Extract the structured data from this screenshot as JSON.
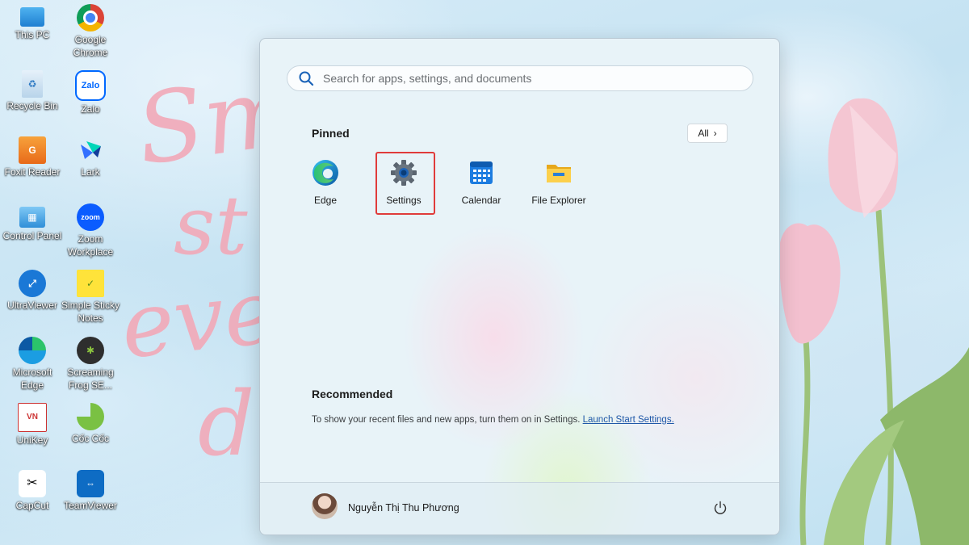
{
  "desktop": {
    "icons": [
      {
        "label": "This PC",
        "icon": "computer-icon"
      },
      {
        "label": "Google Chrome",
        "icon": "chrome-icon"
      },
      {
        "label": "Recycle Bin",
        "icon": "recycle-bin-icon"
      },
      {
        "label": "Zalo",
        "icon": "zalo-icon"
      },
      {
        "label": "Foxit Reader",
        "icon": "foxit-icon"
      },
      {
        "label": "Lark",
        "icon": "lark-icon"
      },
      {
        "label": "Control Panel",
        "icon": "control-panel-icon"
      },
      {
        "label": "Zoom Workplace",
        "icon": "zoom-icon"
      },
      {
        "label": "UltraViewer",
        "icon": "ultraviewer-icon"
      },
      {
        "label": "Simple Sticky Notes",
        "icon": "sticky-notes-icon"
      },
      {
        "label": "Microsoft Edge",
        "icon": "edge-icon"
      },
      {
        "label": "Screaming Frog SE...",
        "icon": "screaming-frog-icon"
      },
      {
        "label": "UniKey",
        "icon": "unikey-icon"
      },
      {
        "label": "Cốc Cốc",
        "icon": "coccoc-icon"
      },
      {
        "label": "CapCut",
        "icon": "capcut-icon"
      },
      {
        "label": "TeamViewer",
        "icon": "teamviewer-icon"
      }
    ]
  },
  "start_menu": {
    "search": {
      "placeholder": "Search for apps, settings, and documents"
    },
    "pinned": {
      "title": "Pinned",
      "all_label": "All",
      "apps": [
        {
          "label": "Edge",
          "icon": "edge-icon"
        },
        {
          "label": "Settings",
          "icon": "settings-gear-icon",
          "highlighted": true
        },
        {
          "label": "Calendar",
          "icon": "calendar-icon"
        },
        {
          "label": "File Explorer",
          "icon": "folder-icon"
        }
      ]
    },
    "recommended": {
      "title": "Recommended",
      "message": "To show your recent files and new apps, turn them on in Settings.",
      "link": "Launch Start Settings."
    },
    "user": {
      "name": "Nguyễn Thị Thu Phương"
    }
  },
  "colors": {
    "highlight": "#e03b3b",
    "link": "#1f58a8"
  }
}
